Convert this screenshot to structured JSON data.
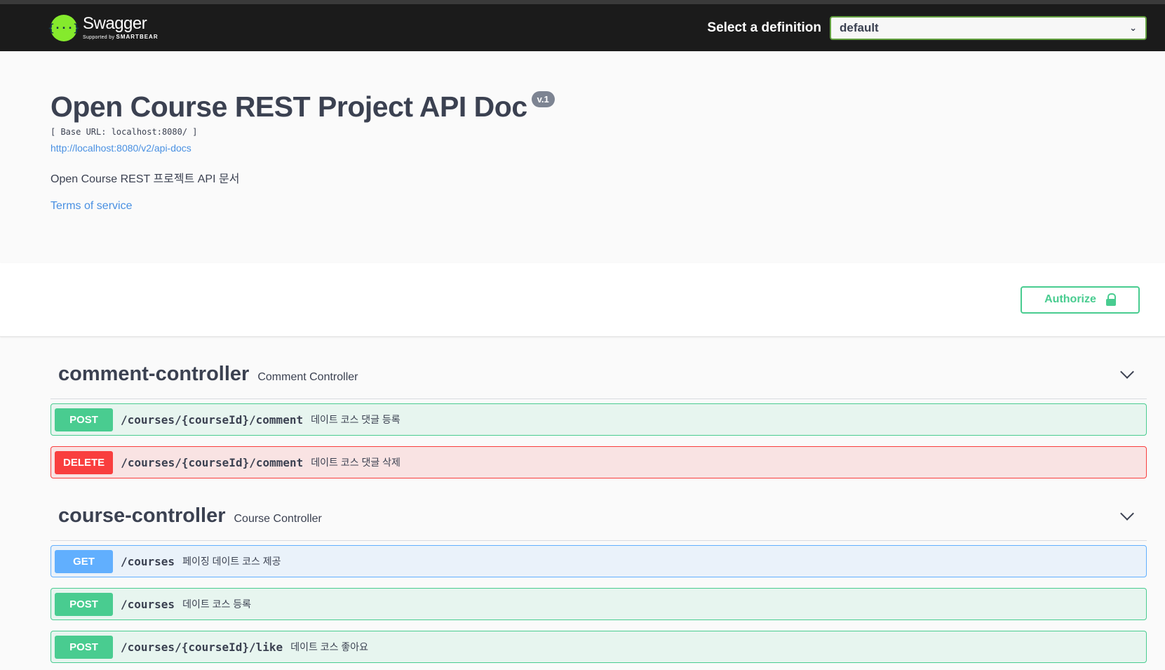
{
  "topbar": {
    "brand_name": "Swagger",
    "brand_sub_prefix": "Supported by",
    "brand_sub_company": "SMARTBEAR",
    "definition_label": "Select a definition",
    "definition_value": "default"
  },
  "info": {
    "title": "Open Course REST Project API Doc",
    "version": "v.1",
    "base_url": "[ Base URL: localhost:8080/ ]",
    "spec_url": "http://localhost:8080/v2/api-docs",
    "description": "Open Course REST 프로젝트 API 문서",
    "terms": "Terms of service"
  },
  "scheme": {
    "authorize_label": "Authorize"
  },
  "tags": [
    {
      "name": "comment-controller",
      "description": "Comment Controller",
      "operations": [
        {
          "method": "POST",
          "path": "/courses/{courseId}/comment",
          "summary": "데이트 코스 댓글 등록"
        },
        {
          "method": "DELETE",
          "path": "/courses/{courseId}/comment",
          "summary": "데이트 코스 댓글 삭제"
        }
      ]
    },
    {
      "name": "course-controller",
      "description": "Course Controller",
      "operations": [
        {
          "method": "GET",
          "path": "/courses",
          "summary": "페이징 데이트 코스 제공"
        },
        {
          "method": "POST",
          "path": "/courses",
          "summary": "데이트 코스 등록"
        },
        {
          "method": "POST",
          "path": "/courses/{courseId}/like",
          "summary": "데이트 코스 좋아요"
        }
      ]
    }
  ],
  "colors": {
    "post": "#49cc90",
    "delete": "#f93e3e",
    "get": "#61affe",
    "brand_green": "#85ea2d",
    "link": "#4990e2"
  }
}
